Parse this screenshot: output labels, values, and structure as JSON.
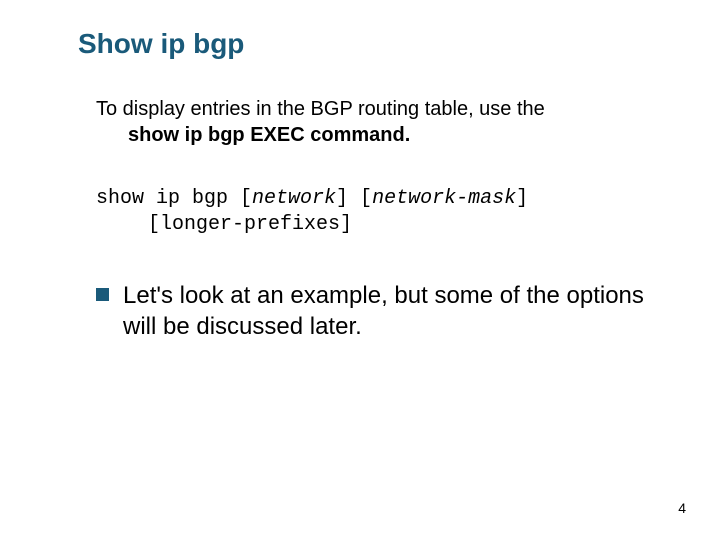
{
  "slide": {
    "title": "Show ip bgp",
    "intro": {
      "line1": "To display entries in the BGP routing table, use the",
      "line2_bold": "show ip bgp EXEC command."
    },
    "syntax": {
      "part1": "show ip bgp [",
      "part1_italic": "network",
      "part2": "] [",
      "part2_italic": "network-mask",
      "part3": "]",
      "indent_part1": "[",
      "indent_bold": "longer-prefixes",
      "indent_part2": "]"
    },
    "bullet": {
      "text": "Let's look at an example, but some of the options will be discussed later."
    },
    "page_number": "4"
  }
}
